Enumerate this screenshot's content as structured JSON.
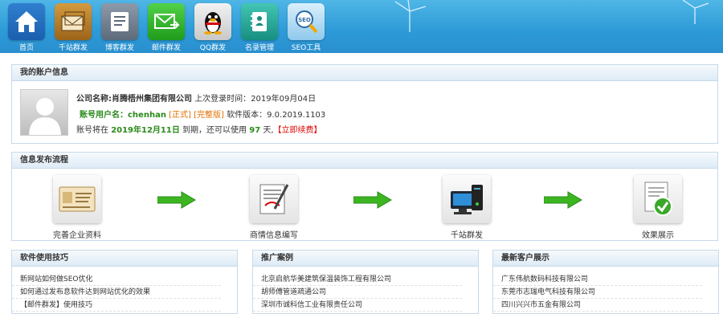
{
  "nav": {
    "items": [
      {
        "label": "首页",
        "icon": "home-icon"
      },
      {
        "label": "千站群发",
        "icon": "mail-stack-icon"
      },
      {
        "label": "博客群发",
        "icon": "blog-icon"
      },
      {
        "label": "邮件群发",
        "icon": "email-send-icon"
      },
      {
        "label": "QQ群发",
        "icon": "qq-penguin-icon"
      },
      {
        "label": "名录管理",
        "icon": "contacts-book-icon"
      },
      {
        "label": "SEO工具",
        "icon": "seo-magnifier-icon"
      }
    ]
  },
  "account": {
    "title": "我的账户信息",
    "company_label": "公司名称:肖腾梧州集团有限公司",
    "last_login_label": "上次登录时间：",
    "last_login": "2019年09月04日",
    "username_label": "账号用户名：",
    "username": "chenhan",
    "status_official": "[正式]",
    "status_full": "[完整版]",
    "version_label": "软件版本：",
    "version": "9.0.2019.1103",
    "expire_prefix": "账号将在",
    "expire_date": "2019年12月11日",
    "expire_mid": "到期，还可以使用",
    "days_left": "97",
    "days_unit": "天,",
    "renew_link": "【立即续费】"
  },
  "flow": {
    "title": "信息发布流程",
    "steps": [
      {
        "label": "完善企业资料",
        "icon": "business-card-icon"
      },
      {
        "label": "商情信息编写",
        "icon": "edit-document-icon"
      },
      {
        "label": "千站群发",
        "icon": "computer-network-icon"
      },
      {
        "label": "效果展示",
        "icon": "checkmark-document-icon"
      }
    ]
  },
  "tips": {
    "title": "软件使用技巧",
    "items": [
      "新网站如何做SEO优化",
      "如何通过发布息软件达到网站优化的效果",
      "【邮件群发】使用技巧"
    ]
  },
  "cases": {
    "title": "推广案例",
    "items": [
      "北京启航华美建筑保温装饰工程有限公司",
      "胡师傅管道疏通公司",
      "深圳市诚科信工业有限责任公司"
    ]
  },
  "clients": {
    "title": "最新客户展示",
    "items": [
      "广东伟航数码科技有限公司",
      "东莞市志瑞电气科技有限公司",
      "四川兴兴市五金有限公司"
    ]
  },
  "colors": {
    "header_blue": "#2c9ad6",
    "accent_green": "#2a8a1a",
    "accent_orange": "#e07000",
    "accent_red": "#e00000"
  }
}
